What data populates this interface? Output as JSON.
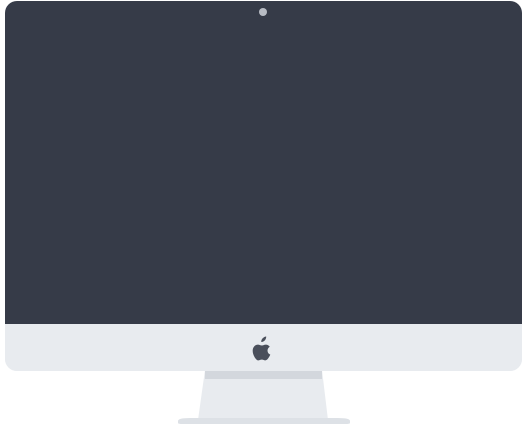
{
  "device": {
    "type": "desktop-monitor",
    "logo_icon": "apple-logo-icon",
    "camera_icon": "camera-dot-icon"
  },
  "colors": {
    "screen": "#363b48",
    "chin": "#e8ebef",
    "camera": "#b8bcc4",
    "logo": "#4a4f5b",
    "stand": "#e8ebef",
    "stand_shadow": "#d3d7dd",
    "stand_base": "#dde1e6"
  }
}
